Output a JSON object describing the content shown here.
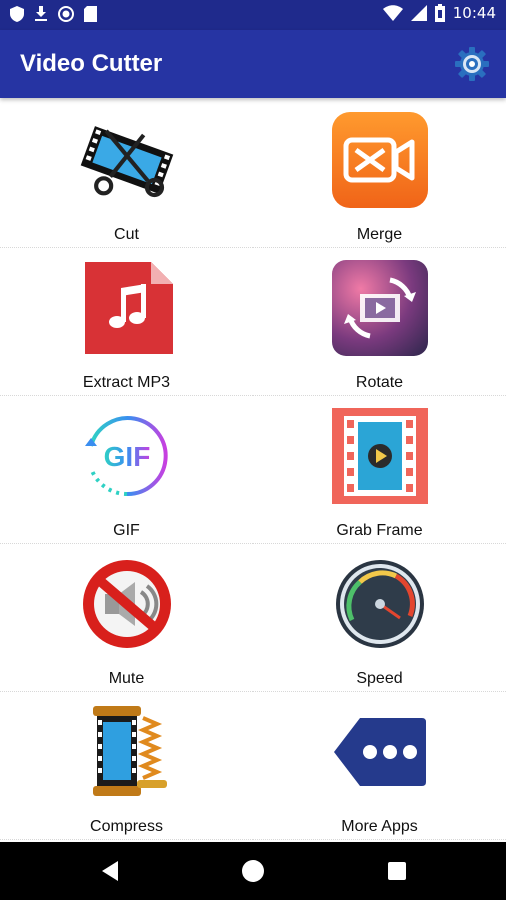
{
  "status_bar": {
    "time": "10:44"
  },
  "app_bar": {
    "title": "Video Cutter"
  },
  "colors": {
    "status_bar": "#1f2a8c",
    "app_bar": "#2634a3",
    "nav_bar": "#000000"
  },
  "tiles": [
    {
      "label": "Cut",
      "icon": "film-scissors-icon"
    },
    {
      "label": "Merge",
      "icon": "merge-video-icon"
    },
    {
      "label": "Extract MP3",
      "icon": "music-file-icon"
    },
    {
      "label": "Rotate",
      "icon": "rotate-video-icon"
    },
    {
      "label": "GIF",
      "icon": "gif-icon"
    },
    {
      "label": "Grab Frame",
      "icon": "film-frame-icon"
    },
    {
      "label": "Mute",
      "icon": "mute-speaker-icon"
    },
    {
      "label": "Speed",
      "icon": "speedometer-icon"
    },
    {
      "label": "Compress",
      "icon": "compress-video-icon"
    },
    {
      "label": "More Apps",
      "icon": "more-apps-icon"
    }
  ]
}
